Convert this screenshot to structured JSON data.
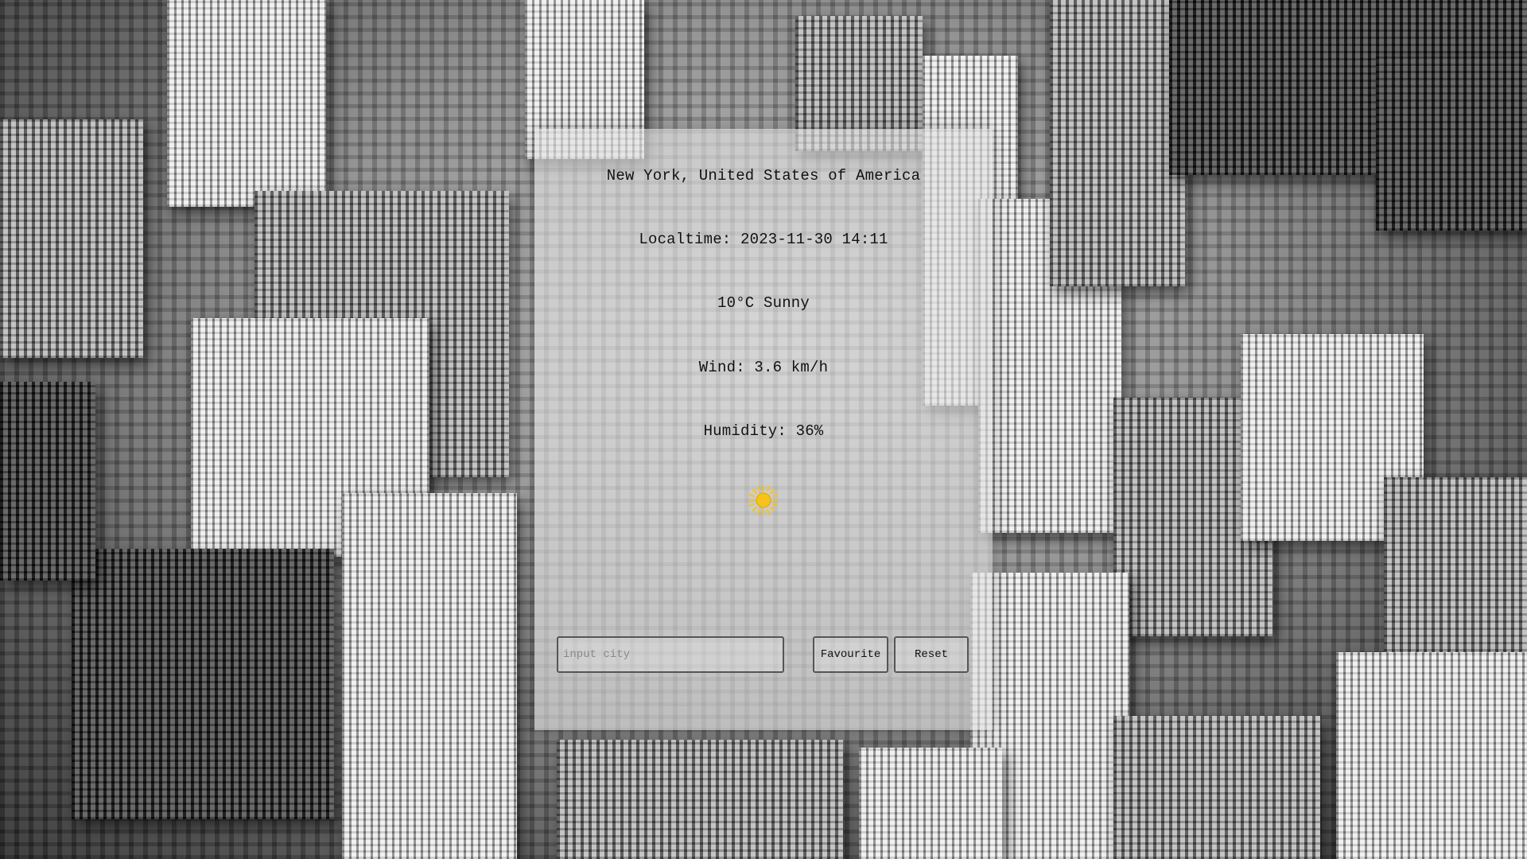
{
  "weather": {
    "location": "New York, United States of America",
    "localtime": "Localtime: 2023-11-30 14:11",
    "condition": "10°C Sunny",
    "wind": "Wind: 3.6 km/h",
    "humidity": "Humidity: 36%",
    "icon": "sun-icon"
  },
  "search": {
    "placeholder": "input city",
    "value": ""
  },
  "buttons": {
    "favourite_label": "Favourite",
    "reset_label": "Reset"
  },
  "colors": {
    "sun": "#f5c518",
    "panel": "#e1e1e1"
  }
}
